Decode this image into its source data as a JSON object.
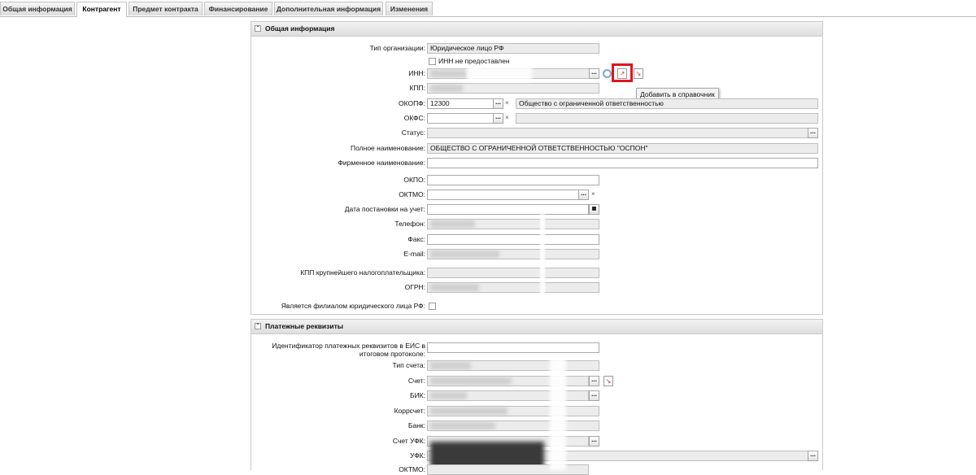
{
  "tabs": [
    "Общая информация",
    "Контрагент",
    "Предмет контракта",
    "Финансирование",
    "Дополнительная информация",
    "Изменения"
  ],
  "active_tab": "Контрагент",
  "general": {
    "title": "Общая информация",
    "org_type_label": "Тип организации:",
    "org_type_value": "Юридическое лицо РФ",
    "inn_not_provided": "ИНН не предоставлен",
    "inn_label": "ИНН:",
    "kpp_label": "КПП:",
    "okopf_label": "ОКОПФ:",
    "okopf_code": "12300",
    "okopf_name": "Общество с ограниченной ответственностью",
    "okfs_label": "ОКФС:",
    "status_label": "Статус:",
    "full_name_label": "Полное наименование:",
    "full_name_value": "ОБЩЕСТВО С ОГРАНИЧЕННОЙ ОТВЕТСТВЕННОСТЬЮ \"ОСПОН\"",
    "brand_name_label": "Фирменное наименование:",
    "okpo_label": "ОКПО:",
    "oktmo_label": "ОКТМО:",
    "reg_date_label": "Дата постановки на учет:",
    "phone_label": "Телефон:",
    "fax_label": "Факс:",
    "email_label": "E-mail:",
    "kpp_major_label": "КПП крупнейшего налогоплательщика:",
    "ogrn_label": "ОГРН:",
    "branch_label": "Является филиалом юридического лица РФ:",
    "tooltip": "Добавить в справочник"
  },
  "payment": {
    "title": "Платежные реквизиты",
    "eis_label_1": "Идентификатор платежных реквизитов в ЕИС в",
    "eis_label_2": "итоговом протоколе:",
    "account_type_label": "Тип счета:",
    "account_label": "Счет:",
    "bik_label": "БИК:",
    "corr_label": "Коррсчет:",
    "bank_label": "Банк:",
    "ufk_account_label": "Счет УФК:",
    "ufk_label": "УФК:",
    "oktmo_label": "ОКТМО:"
  },
  "glyphs": {
    "dots": "...",
    "clear": "×",
    "collapse": "⌃"
  }
}
